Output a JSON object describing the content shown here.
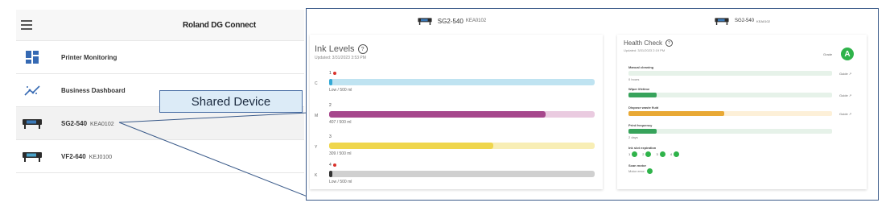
{
  "left": {
    "brand": "Roland DG Connect",
    "nav": [
      {
        "label": "Printer Monitoring",
        "sub": ""
      },
      {
        "label": "Business Dashboard",
        "sub": ""
      },
      {
        "label": "SG2-540",
        "sub": "KEA0102"
      },
      {
        "label": "VF2-640",
        "sub": "KEJ0100"
      }
    ]
  },
  "callout": "Shared Device",
  "frame": {
    "left_header": {
      "model": "SG2-540",
      "sub": "KEA0102"
    },
    "right_header": {
      "model": "SG2-540",
      "sub": "KEA0102"
    },
    "ink": {
      "title": "Ink Levels",
      "updated": "Updated: 3/31/2023 3:53 PM",
      "rows": [
        {
          "code": "C",
          "top": "1",
          "amount": "Low / 500 ml",
          "fraction": 0.01,
          "color": "#33a9d6",
          "track": "#bfe3f1",
          "warn": true
        },
        {
          "code": "M",
          "top": "2",
          "amount": "407 / 500 ml",
          "fraction": 0.814,
          "color": "#a6478c",
          "track": "#eacbe0",
          "warn": false
        },
        {
          "code": "Y",
          "top": "3",
          "amount": "309 / 500 ml",
          "fraction": 0.618,
          "color": "#efd64c",
          "track": "#f8eeb5",
          "warn": false
        },
        {
          "code": "K",
          "top": "4",
          "amount": "Low / 500 ml",
          "fraction": 0.01,
          "color": "#333333",
          "track": "#d0d0d0",
          "warn": true
        }
      ]
    },
    "health": {
      "title": "Health Check",
      "updated": "Updated: 3/31/2023 2:19 PM",
      "grade_label": "Grade",
      "grade": "A",
      "guide_label": "Guide",
      "items": [
        {
          "label": "Manual cleaning",
          "text": "0 hours",
          "fraction": 0.0,
          "color": "#37a35b",
          "track": "#e6f2e9",
          "guide": true
        },
        {
          "label": "Wiper lifetime",
          "text": "",
          "fraction": 0.14,
          "color": "#37a35b",
          "track": "#e6f2e9",
          "guide": true
        },
        {
          "label": "Dispose waste fluid",
          "text": "",
          "fraction": 0.47,
          "color": "#e9a935",
          "track": "#fdf0d8",
          "guide": true
        },
        {
          "label": "Print frequency",
          "text": "2 days",
          "fraction": 0.14,
          "color": "#37a35b",
          "track": "#e6f2e9",
          "guide": false
        }
      ],
      "ink_slot": {
        "label": "Ink slot expiration",
        "slots": [
          "1",
          "2",
          "3",
          "4"
        ]
      },
      "scan_motor": {
        "label": "Scan motor",
        "text": "Motor error"
      }
    }
  }
}
